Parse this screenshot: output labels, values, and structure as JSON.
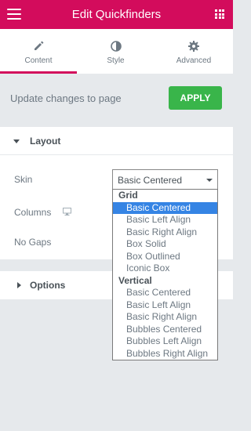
{
  "header": {
    "title": "Edit Quickfinders",
    "menu_icon": "hamburger-icon",
    "apps_icon": "grid-icon"
  },
  "tabs": [
    {
      "label": "Content",
      "icon": "pencil-icon",
      "active": true
    },
    {
      "label": "Style",
      "icon": "contrast-icon",
      "active": false
    },
    {
      "label": "Advanced",
      "icon": "gear-icon",
      "active": false
    }
  ],
  "apply_bar": {
    "message": "Update changes to page",
    "button_label": "APPLY"
  },
  "layout_section": {
    "title": "Layout",
    "expanded": true,
    "controls": {
      "skin_label": "Skin",
      "skin_value": "Basic Centered",
      "columns_label": "Columns",
      "no_gaps_label": "No Gaps"
    }
  },
  "skin_dropdown": {
    "groups": [
      {
        "label": "Grid",
        "options": [
          "Basic Centered",
          "Basic Left Align",
          "Basic Right Align",
          "Box Solid",
          "Box Outlined",
          "Iconic Box"
        ]
      },
      {
        "label": "Vertical",
        "options": [
          "Basic Centered",
          "Basic Left Align",
          "Basic Right Align",
          "Bubbles Centered",
          "Bubbles Left Align",
          "Bubbles Right Align"
        ]
      }
    ],
    "selected": "Grid / Basic Centered"
  },
  "options_section": {
    "title": "Options",
    "expanded": false
  },
  "colors": {
    "brand": "#d30c5c",
    "apply_green": "#39b54a",
    "selection_blue": "#3584e4",
    "panel_bg": "#e6e9ec"
  }
}
